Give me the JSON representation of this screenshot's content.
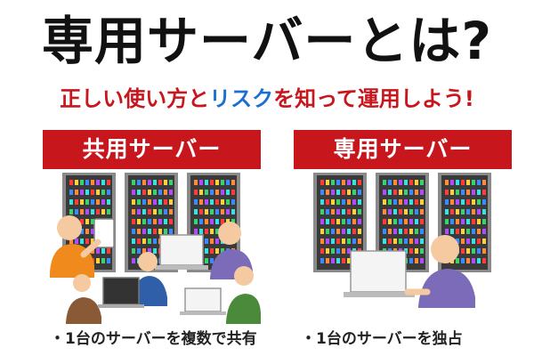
{
  "title": "専用サーバーとは?",
  "subtitle": {
    "part1": "正しい使い方と",
    "part2": "リスク",
    "part3": "を知って運用しよう!"
  },
  "panels": [
    {
      "banner": "共用サーバー",
      "caption": "・1台のサーバーを複数で共有"
    },
    {
      "banner": "専用サーバー",
      "caption": "・1台のサーバーを独占"
    }
  ],
  "colors": {
    "banner": "#c8161d",
    "subtitle_red": "#c8161d",
    "subtitle_blue": "#1a6fd0",
    "rack": "#3a3a3a",
    "rack_frame": "#8a8a8a",
    "person_orange": "#f08a1c",
    "person_purple": "#7b6bb8",
    "person_blue": "#2f5fa8",
    "person_green": "#4a8a3a",
    "skin": "#f6caa0"
  }
}
